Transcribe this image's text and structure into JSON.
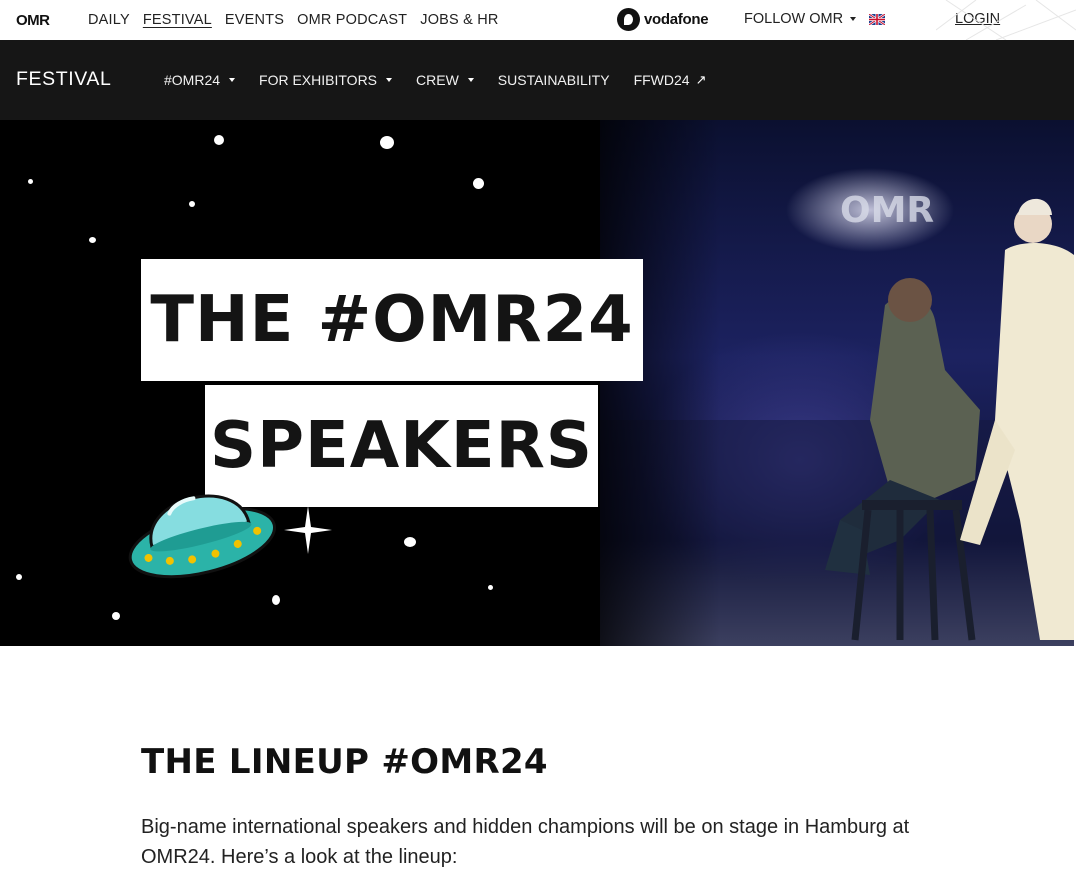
{
  "topbar": {
    "logo": "OMR",
    "nav": [
      {
        "label": "DAILY"
      },
      {
        "label": "FESTIVAL"
      },
      {
        "label": "EVENTS"
      },
      {
        "label": "OMR PODCAST"
      },
      {
        "label": "JOBS & HR"
      }
    ],
    "active_nav": "FESTIVAL",
    "sponsor": "vodafone",
    "follow_label": "FOLLOW OMR",
    "language_flag": "uk-flag-icon",
    "login_label": "LOGIN"
  },
  "festival_nav": {
    "title": "FESTIVAL",
    "items": [
      {
        "label": "#OMR24",
        "dropdown": true
      },
      {
        "label": "FOR EXHIBITORS",
        "dropdown": true
      },
      {
        "label": "CREW",
        "dropdown": true
      },
      {
        "label": "SUSTAINABILITY",
        "dropdown": false
      },
      {
        "label": "FFWD24",
        "external": true
      }
    ]
  },
  "hero": {
    "headline_line1": "THE #OMR24",
    "headline_line2": "SPEAKERS"
  },
  "lineup": {
    "title": "THE LINEUP #OMR24",
    "text": "Big-name international speakers and hidden champions will be on stage in Hamburg at OMR24. Here’s a look at the lineup:"
  },
  "colors": {
    "nav_bg": "#161616",
    "hero_bg": "#000000",
    "ufo_teal": "#2bb3a8",
    "ufo_dome": "#86dde0",
    "ufo_lights": "#f2c200"
  }
}
